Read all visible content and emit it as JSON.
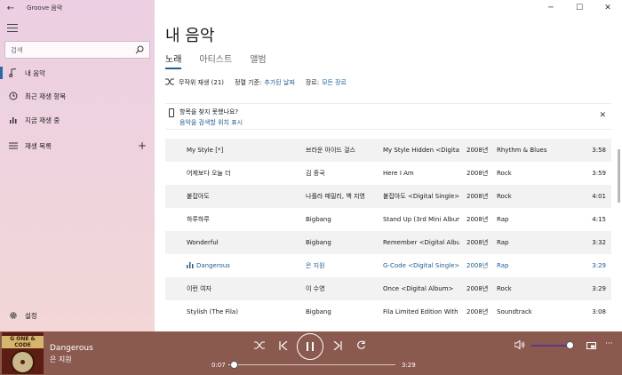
{
  "app": {
    "title": "Groove 음악",
    "back_glyph": "←"
  },
  "window": {
    "minimize": "─",
    "maximize": "☐",
    "close": "✕"
  },
  "sidebar": {
    "search_placeholder": "검색",
    "items": [
      {
        "label": "내 음악",
        "active": true
      },
      {
        "label": "최근 재생 항목"
      },
      {
        "label": "지금 재생 중"
      },
      {
        "label": "재생 목록"
      }
    ],
    "add_glyph": "+",
    "settings_label": "설정"
  },
  "main": {
    "title": "내 음악",
    "tabs": [
      "노래",
      "아티스트",
      "앨범"
    ],
    "active_tab": "노래",
    "shuffle_label": "무작위 재생 (21)",
    "sort_prefix": "정렬 기준:",
    "sort_value": "추가된 날짜",
    "genre_prefix": "장르:",
    "genre_value": "모든 장르",
    "notice_title": "항목을 찾지 못했나요?",
    "notice_link": "음악을 검색할 위치 표시",
    "notice_close": "✕"
  },
  "songs": [
    {
      "title": "My Style [*]",
      "artist": "브라운 아이드 걸스",
      "album": "My Style Hidden <Digital",
      "year": "2008년",
      "genre": "Rhythm & Blues",
      "duration": "3:58"
    },
    {
      "title": "어제보다 오늘 더",
      "artist": "김 종국",
      "album": "Here I Am",
      "year": "2008년",
      "genre": "Rock",
      "duration": "3:59"
    },
    {
      "title": "붙잡아도",
      "artist": "나플라 패밀리, 백 지영",
      "album": "붙잡아도 <Digital Single>",
      "year": "2008년",
      "genre": "Rock",
      "duration": "4:01"
    },
    {
      "title": "하루하루",
      "artist": "Bigbang",
      "album": "Stand Up (3rd Mini Album",
      "year": "2008년",
      "genre": "Rap",
      "duration": "4:15"
    },
    {
      "title": "Wonderful",
      "artist": "Bigbang",
      "album": "Remember <Digital Albun",
      "year": "2008년",
      "genre": "Rap",
      "duration": "3:32"
    },
    {
      "title": "Dangerous",
      "artist": "은 지원",
      "album": "G-Code <Digital Single>",
      "year": "2008년",
      "genre": "Rap",
      "duration": "3:29",
      "playing": true
    },
    {
      "title": "이런 여자",
      "artist": "이 수영",
      "album": "Once <Digital Album>",
      "year": "2008년",
      "genre": "Rock",
      "duration": "3:29"
    },
    {
      "title": "Stylish (The Fila)",
      "artist": "Bigbang",
      "album": "Fila Limited Edition With I",
      "year": "2008년",
      "genre": "Soundtrack",
      "duration": "3:08"
    }
  ],
  "player": {
    "title": "Dangerous",
    "artist": "은 지원",
    "album_art_text": "G ONE & CODE",
    "current_time": "0:07",
    "total_time": "3:29",
    "progress": 0.033,
    "volume": 0.9,
    "more_glyph": "···"
  },
  "colors": {
    "accent": "#1f5e96",
    "player_bg": "#8a5a4f",
    "volume": "#5a3a86"
  },
  "icons": [
    "back-icon",
    "hamburger-icon",
    "search-icon",
    "music-note-icon",
    "clock-icon",
    "bar-chart-icon",
    "playlist-icon",
    "plus-icon",
    "gear-icon",
    "shuffle-icon",
    "previous-icon",
    "pause-icon",
    "next-icon",
    "repeat-icon",
    "volume-icon",
    "miniplayer-icon",
    "more-icon"
  ]
}
